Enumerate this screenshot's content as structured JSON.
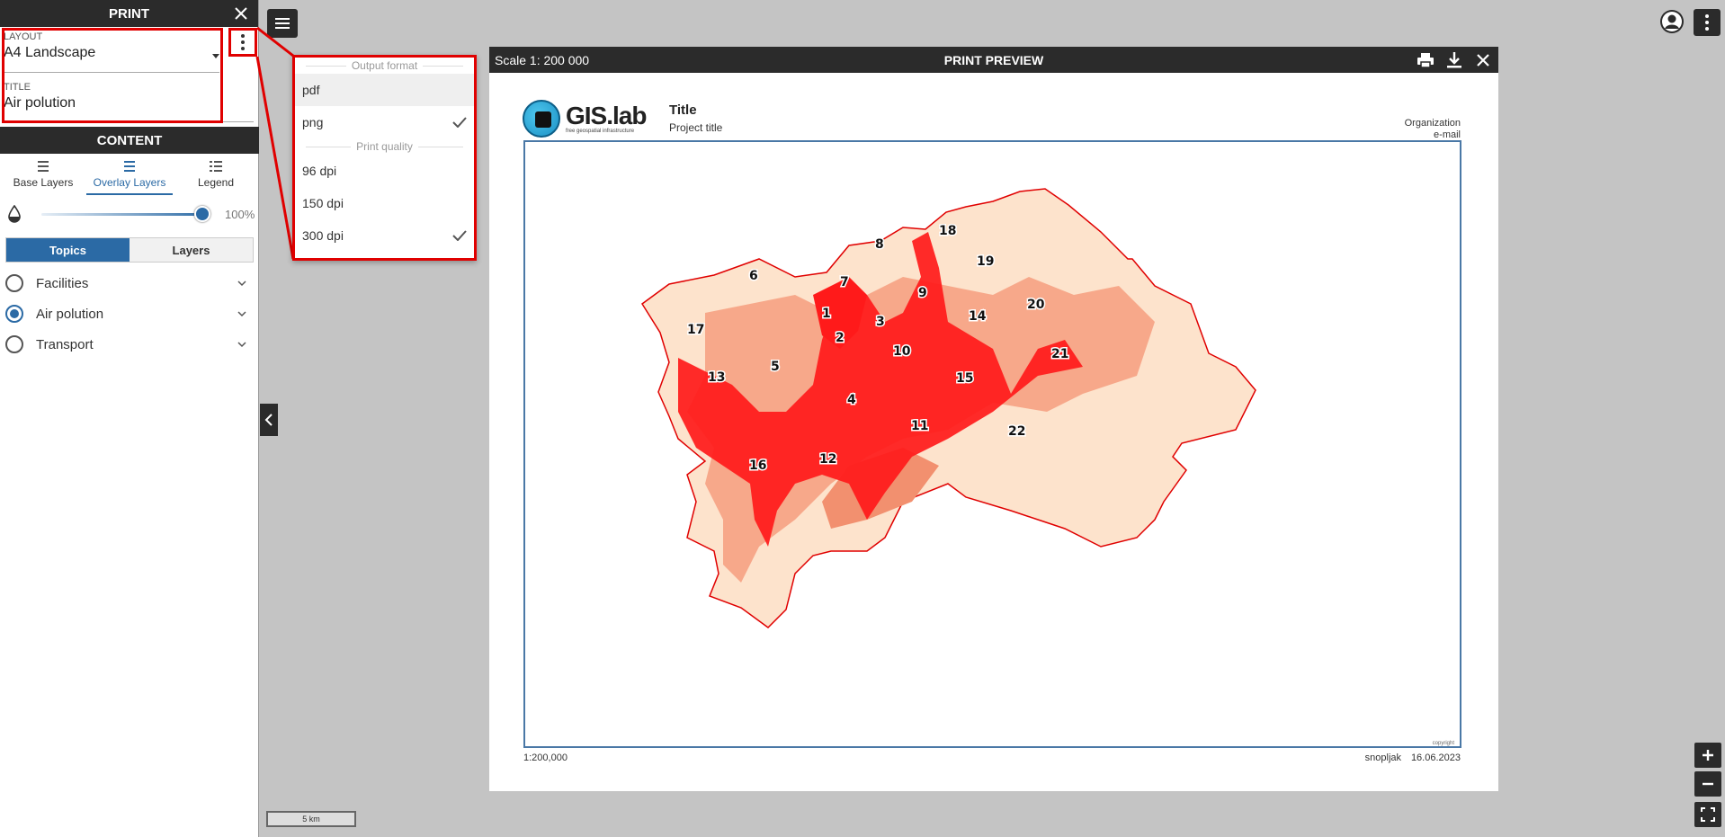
{
  "panel": {
    "title": "PRINT",
    "layout": {
      "label": "LAYOUT",
      "value": "A4 Landscape"
    },
    "title_field": {
      "label": "TITLE",
      "value": "Air polution"
    },
    "content_title": "CONTENT",
    "tabs": [
      {
        "label": "Base Layers",
        "active": false
      },
      {
        "label": "Overlay Layers",
        "active": true
      },
      {
        "label": "Legend",
        "active": false
      }
    ],
    "opacity": {
      "value_label": "100%",
      "fraction": 1.0
    },
    "segments": {
      "topics": "Topics",
      "layers": "Layers",
      "selected": "Topics"
    },
    "topics": [
      {
        "label": "Facilities",
        "selected": false
      },
      {
        "label": "Air polution",
        "selected": true
      },
      {
        "label": "Transport",
        "selected": false
      }
    ]
  },
  "dropdown": {
    "format_header": "Output format",
    "formats": [
      {
        "label": "pdf",
        "checked": false,
        "highlighted": true
      },
      {
        "label": "png",
        "checked": true,
        "highlighted": false
      }
    ],
    "quality_header": "Print quality",
    "qualities": [
      {
        "label": "96 dpi",
        "checked": false
      },
      {
        "label": "150 dpi",
        "checked": false
      },
      {
        "label": "300 dpi",
        "checked": true
      }
    ]
  },
  "preview": {
    "scale_label": "Scale 1: 200 000",
    "title": "PRINT PREVIEW",
    "logo_text": "GIS.lab",
    "logo_sub": "free geospatial infrastructure",
    "map_title": "Title",
    "project_title": "Project title",
    "organization": "Organization",
    "email": "e-mail",
    "copyright": "copyright",
    "scale_text": "1:200,000",
    "author": "snopljak",
    "date": "16.06.2023",
    "district_labels": [
      "1",
      "2",
      "3",
      "4",
      "5",
      "6",
      "7",
      "8",
      "9",
      "10",
      "11",
      "12",
      "13",
      "14",
      "15",
      "16",
      "17",
      "18",
      "19",
      "20",
      "21",
      "22"
    ]
  },
  "map": {
    "scalebar": "5 km"
  },
  "colors": {
    "dark": "#2b2b2b",
    "accent": "#2b6aa5",
    "highlight": "#e00000",
    "pollution_high": "#ff1a1a",
    "pollution_mid": "#f7a88a",
    "pollution_low": "#fde3cc"
  }
}
